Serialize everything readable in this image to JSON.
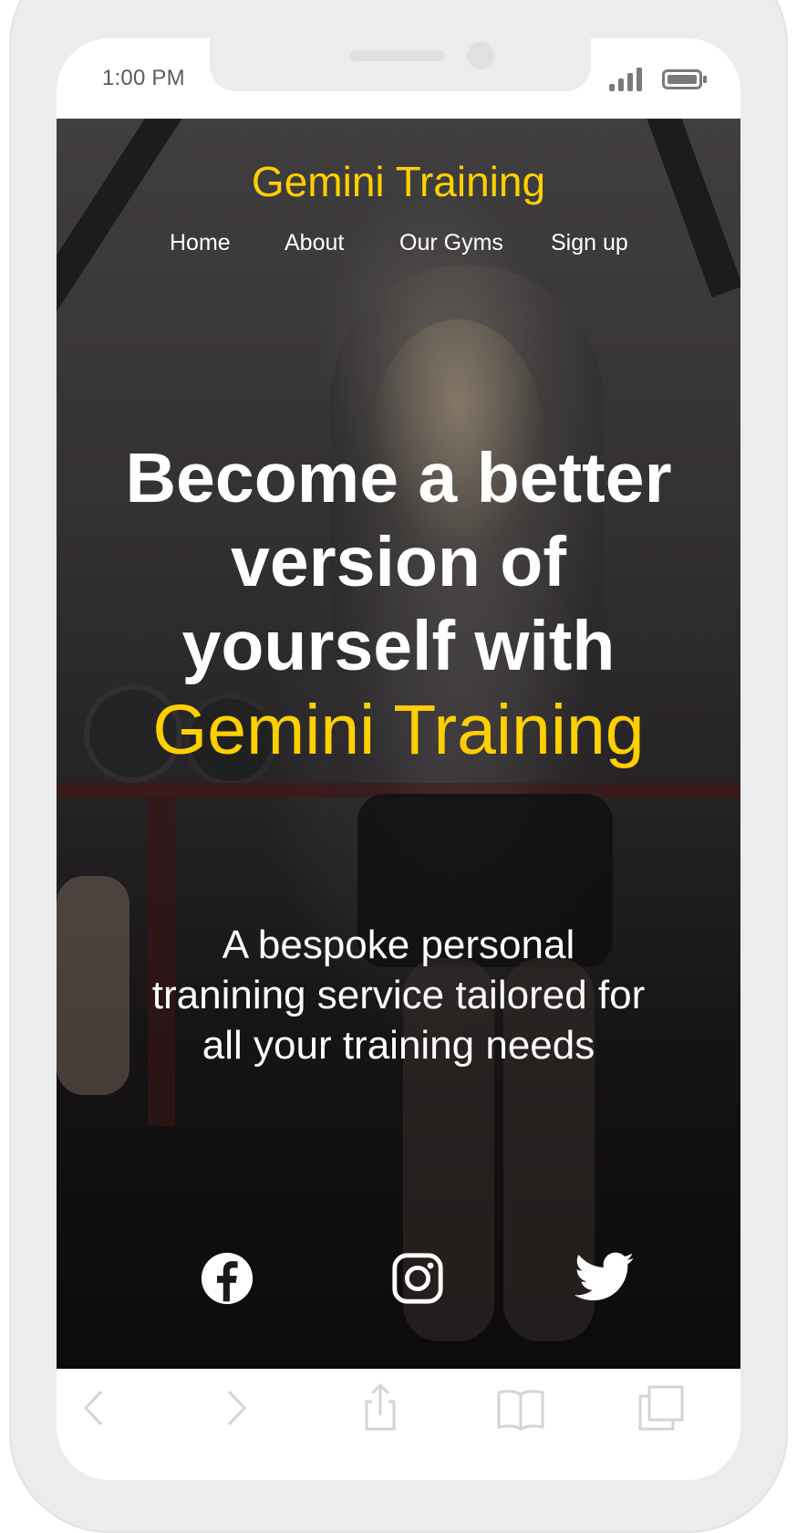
{
  "status_bar": {
    "time": "1:00 PM"
  },
  "site": {
    "brand": "Gemini Training",
    "nav": [
      "Home",
      "About",
      "Our Gyms",
      "Sign up"
    ],
    "headline_line1": "Become a better",
    "headline_line2": "version of",
    "headline_line3": "yourself with",
    "headline_accent": "Gemini Training",
    "subtext_line1": "A bespoke personal",
    "subtext_line2": "tranining service tailored for",
    "subtext_line3": "all your training needs",
    "social_icons": [
      "facebook-icon",
      "instagram-icon",
      "twitter-icon"
    ]
  },
  "browser_toolbar": {
    "icons": [
      "back-arrow-icon",
      "forward-arrow-icon",
      "share-icon",
      "bookmarks-icon",
      "tabs-icon"
    ]
  },
  "colors": {
    "accent": "#ffd000",
    "text": "#ffffff",
    "frame": "#ececec"
  }
}
